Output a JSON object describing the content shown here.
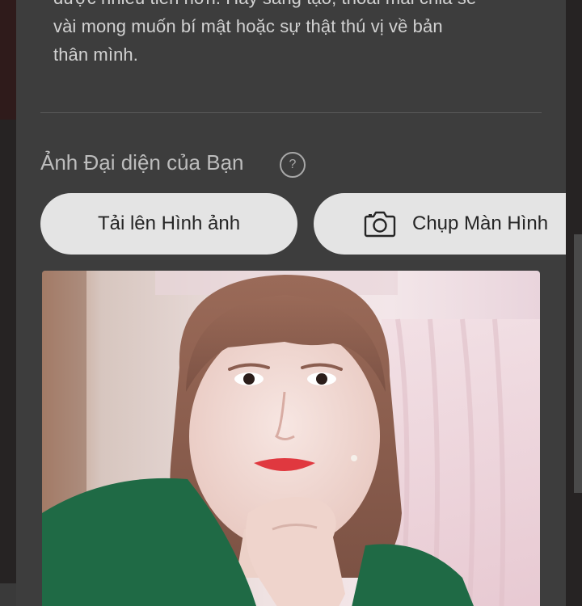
{
  "profile": {
    "intro_text": "được nhiều tiền hơn. Hãy sáng tạo, thoải mái chia sẻ\nvài mong muốn bí mật hoặc sự thật thú vị về bản\nthân mình.",
    "avatar_section_title": "Ảnh Đại diện của Bạn",
    "help_icon": "question-circle-icon",
    "help_symbol": "?",
    "upload_button_label": "Tải lên Hình ảnh",
    "capture_button_label": "Chụp Màn Hình",
    "capture_icon": "camera-icon"
  },
  "colors": {
    "modal_background": "#3d3d3d",
    "button_background": "#e4e4e4",
    "text_primary": "#d2d2d2"
  }
}
